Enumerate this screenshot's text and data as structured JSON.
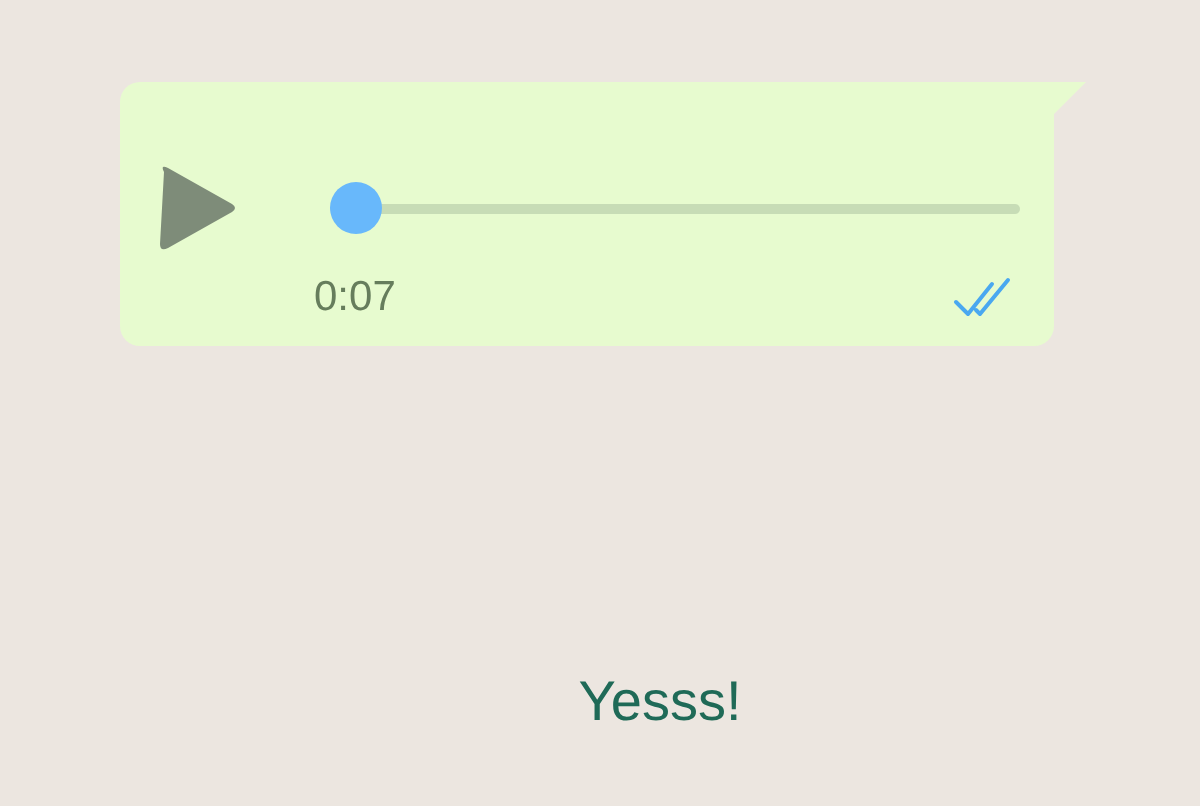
{
  "voice_message": {
    "playing": false,
    "level": 0.0,
    "duration": "0:07",
    "read": true
  },
  "message": {
    "text": "Yesss!"
  }
}
